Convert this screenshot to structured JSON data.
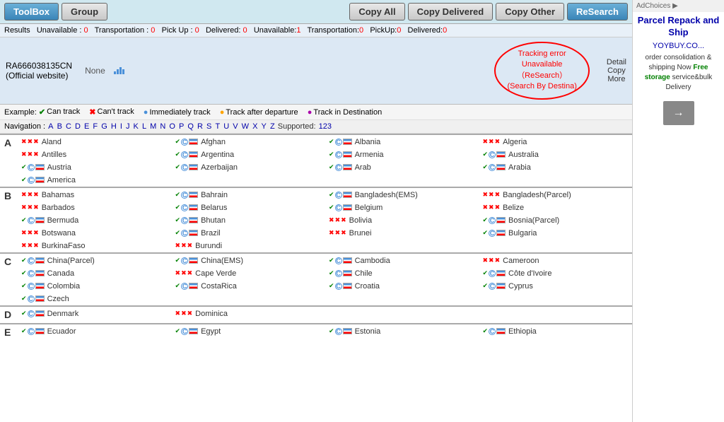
{
  "toolbar": {
    "toolbox_label": "ToolBox",
    "group_label": "Group",
    "copy_all_label": "Copy All",
    "copy_delivered_label": "Copy Delivered",
    "copy_other_label": "Copy Other",
    "research_label": "ReSearch"
  },
  "results": {
    "text": "Results  Unavailable : 0  Transportation : 0  Pick Up : 0  Delivered: 0  Unavailable:1  Transportation:0  PickUp:0  Delivered:0"
  },
  "tracking": {
    "id": "RA666038135CN",
    "official": "(Official website)",
    "none_label": "None",
    "error_line1": "Tracking error",
    "error_line2": "Unavailable",
    "error_line3": "（ReSearch）",
    "error_line4": "(Search By Destina)",
    "detail_label": "Detail",
    "copy_label": "Copy",
    "more_label": "More"
  },
  "legend": {
    "can_track": "Can track",
    "cant_track": "Can't track",
    "immediately": "Immediately track",
    "after_departure": "Track after departure",
    "in_destination": "Track in Destination"
  },
  "nav": {
    "letters": [
      "A",
      "B",
      "C",
      "D",
      "E",
      "F",
      "G",
      "H",
      "I",
      "J",
      "K",
      "L",
      "M",
      "N",
      "O",
      "P",
      "Q",
      "R",
      "S",
      "T",
      "U",
      "V",
      "W",
      "X",
      "Y",
      "Z"
    ],
    "supported_label": "Supported:",
    "supported_link": "123"
  },
  "sections": {
    "A": {
      "letter": "A",
      "countries": [
        {
          "name": "Aland",
          "row": 0,
          "icons": "xxx"
        },
        {
          "name": "Afghan",
          "row": 0,
          "icons": "check-c-flag"
        },
        {
          "name": "Albania",
          "row": 0,
          "icons": "check-c-flag"
        },
        {
          "name": "Algeria",
          "row": 0,
          "icons": "xxx"
        },
        {
          "name": "Antilles",
          "row": 1,
          "icons": "xxx"
        },
        {
          "name": "Argentina",
          "row": 1,
          "icons": "check-c-flag"
        },
        {
          "name": "Armenia",
          "row": 1,
          "icons": "check-c-flag"
        },
        {
          "name": "Australia",
          "row": 1,
          "icons": "check-c-flag"
        },
        {
          "name": "Austria",
          "row": 2,
          "icons": "check-c-flag"
        },
        {
          "name": "Azerbaijan",
          "row": 2,
          "icons": "check-c-flag"
        },
        {
          "name": "Arab",
          "row": 2,
          "icons": "check-c-flag"
        },
        {
          "name": "Arabia",
          "row": 2,
          "icons": "check-c-flag"
        },
        {
          "name": "America",
          "row": 3,
          "icons": "check-c-flag"
        }
      ]
    },
    "B": {
      "letter": "B",
      "countries": [
        {
          "name": "Bahamas",
          "row": 0,
          "icons": "xxx"
        },
        {
          "name": "Bahrain",
          "row": 0,
          "icons": "check-c-flag"
        },
        {
          "name": "Bangladesh(EMS)",
          "row": 0,
          "icons": "check-c-flag"
        },
        {
          "name": "Bangladesh(Parcel)",
          "row": 0,
          "icons": "xxx"
        },
        {
          "name": "Barbados",
          "row": 1,
          "icons": "xxx"
        },
        {
          "name": "Belarus",
          "row": 1,
          "icons": "check-c-flag"
        },
        {
          "name": "Belgium",
          "row": 1,
          "icons": "check-c-flag"
        },
        {
          "name": "Belize",
          "row": 1,
          "icons": "xxx"
        },
        {
          "name": "Bermuda",
          "row": 2,
          "icons": "check-c-flag"
        },
        {
          "name": "Bhutan",
          "row": 2,
          "icons": "check-c-flag"
        },
        {
          "name": "Bolivia",
          "row": 2,
          "icons": "xxx"
        },
        {
          "name": "Bosnia(Parcel)",
          "row": 2,
          "icons": "check-c-flag"
        },
        {
          "name": "Botswana",
          "row": 3,
          "icons": "xxx"
        },
        {
          "name": "Brazil",
          "row": 3,
          "icons": "check-c-flag"
        },
        {
          "name": "Brunei",
          "row": 3,
          "icons": "xxx"
        },
        {
          "name": "Bulgaria",
          "row": 3,
          "icons": "check-c-flag"
        },
        {
          "name": "BurkinaFaso",
          "row": 4,
          "icons": "xxx"
        },
        {
          "name": "Burundi",
          "row": 4,
          "icons": "xxx"
        }
      ]
    },
    "C": {
      "letter": "C",
      "countries": [
        {
          "name": "China(Parcel)",
          "row": 0,
          "icons": "check-c-flag"
        },
        {
          "name": "China(EMS)",
          "row": 0,
          "icons": "check-c-flag"
        },
        {
          "name": "Cambodia",
          "row": 0,
          "icons": "check-c-flag"
        },
        {
          "name": "Cameroon",
          "row": 0,
          "icons": "xxx"
        },
        {
          "name": "Canada",
          "row": 1,
          "icons": "check-c-flag"
        },
        {
          "name": "Cape Verde",
          "row": 1,
          "icons": "xxx"
        },
        {
          "name": "Chile",
          "row": 1,
          "icons": "check-c-flag"
        },
        {
          "name": "Côte d'Ivoire",
          "row": 1,
          "icons": "check-c-flag"
        },
        {
          "name": "Colombia",
          "row": 2,
          "icons": "check-c-flag"
        },
        {
          "name": "CostaRica",
          "row": 2,
          "icons": "check-c-flag"
        },
        {
          "name": "Croatia",
          "row": 2,
          "icons": "check-c-flag"
        },
        {
          "name": "Cyprus",
          "row": 2,
          "icons": "check-c-flag"
        },
        {
          "name": "Czech",
          "row": 3,
          "icons": "check-c-flag"
        }
      ]
    },
    "D": {
      "letter": "D",
      "countries": [
        {
          "name": "Denmark",
          "row": 0,
          "icons": "check-c-flag"
        },
        {
          "name": "Dominica",
          "row": 0,
          "icons": "xxx"
        }
      ]
    },
    "E": {
      "letter": "E",
      "countries": [
        {
          "name": "Ecuador",
          "row": 0,
          "icons": "check-c-flag"
        },
        {
          "name": "Egypt",
          "row": 0,
          "icons": "check-c-flag"
        },
        {
          "name": "Estonia",
          "row": 0,
          "icons": "check-c-flag"
        },
        {
          "name": "Ethiopia",
          "row": 0,
          "icons": "check-c-flag"
        }
      ]
    }
  },
  "sidebar": {
    "ad_choices": "AdChoices ▶",
    "ad_title": "Parcel Repack and Ship",
    "company": "YOYBUY.CO...",
    "description": "order consolidation & shipping Now Free storage service&bulk Delivery",
    "arrow": "→"
  }
}
